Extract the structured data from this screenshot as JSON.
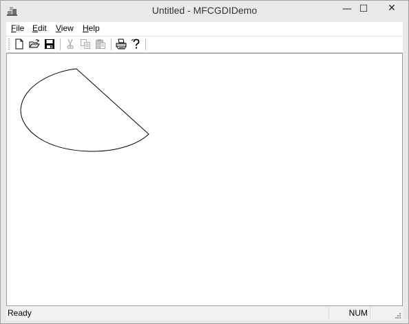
{
  "window": {
    "title": "Untitled - MFCGDIDemo",
    "app_icon": "mfc-app-icon",
    "controls": {
      "minimize": "—",
      "maximize": "☐",
      "close": "✕"
    }
  },
  "menu": {
    "items": [
      {
        "mnemonic": "F",
        "rest": "ile"
      },
      {
        "mnemonic": "E",
        "rest": "dit"
      },
      {
        "mnemonic": "V",
        "rest": "iew"
      },
      {
        "mnemonic": "H",
        "rest": "elp"
      }
    ]
  },
  "toolbar": {
    "buttons": [
      "new-icon",
      "open-icon",
      "save-icon",
      "cut-icon",
      "copy-icon",
      "paste-icon",
      "print-icon",
      "help-icon"
    ],
    "disabled": [
      "cut-icon",
      "copy-icon",
      "paste-icon"
    ]
  },
  "status": {
    "text": "Ready",
    "num": "NUM"
  },
  "colors": {
    "chrome": "#e9e9e9",
    "client": "#ffffff",
    "disabled_icon": "#a8a8a8"
  }
}
